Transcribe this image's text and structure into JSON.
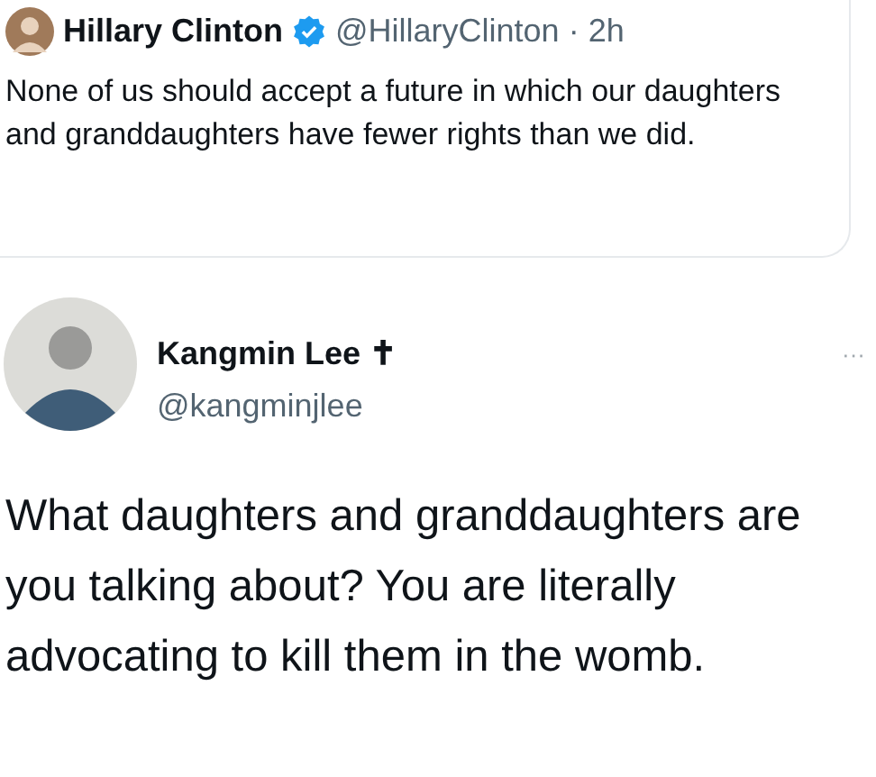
{
  "quoted_tweet": {
    "author_name": "Hillary Clinton",
    "verified": true,
    "handle": "@HillaryClinton",
    "separator": "·",
    "time": "2h",
    "text": "None of us should accept a future in which our daughters and granddaughters have fewer rights than we did."
  },
  "reply_tweet": {
    "author_name": "Kangmin Lee ✝",
    "handle": "@kangminjlee",
    "more": "···",
    "text": "What daughters and granddaughters are you talking about? You are literally advocating to kill them in the womb."
  }
}
